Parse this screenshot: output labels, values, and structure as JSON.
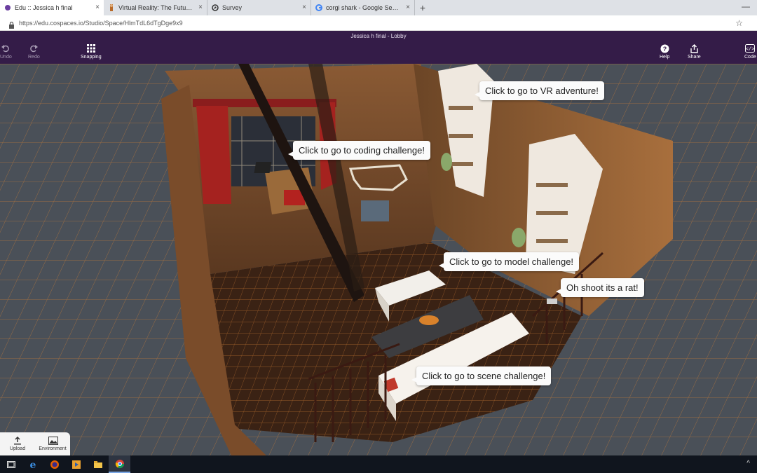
{
  "browser": {
    "tabs": [
      {
        "label": "Edu :: Jessica h final",
        "icon": "cospaces-icon",
        "active": true
      },
      {
        "label": "Virtual Reality: The Future is Now",
        "icon": "person-icon",
        "active": false
      },
      {
        "label": "Survey",
        "icon": "compass-icon",
        "active": false
      },
      {
        "label": "corgi shark - Google Search",
        "icon": "google-icon",
        "active": false
      }
    ],
    "new_tab": "+",
    "close": "×",
    "minimize": "—",
    "url": "https://edu.cospaces.io/Studio/Space/HlmTdL6dTgDge9x9"
  },
  "app": {
    "title": "Jessica h final - Lobby",
    "tools": {
      "undo": "Undo",
      "redo": "Redo",
      "snapping": "Snapping",
      "help": "Help",
      "share": "Share",
      "code": "Code"
    },
    "accent": "#341c48"
  },
  "scene": {
    "bubbles": {
      "vr": "Click to go to VR adventure!",
      "coding": "Click to go to coding challenge!",
      "model": "Click to go to model challenge!",
      "rat": "Oh shoot its a rat!",
      "scene": "Click to go to scene challenge!"
    }
  },
  "bottom_panel": {
    "upload": "Upload",
    "environment": "Environment"
  },
  "taskbar": {
    "apps": [
      "task-view-icon",
      "edge-icon",
      "firefox-icon",
      "media-player-icon",
      "file-explorer-icon",
      "chrome-icon"
    ],
    "tray": "^"
  }
}
